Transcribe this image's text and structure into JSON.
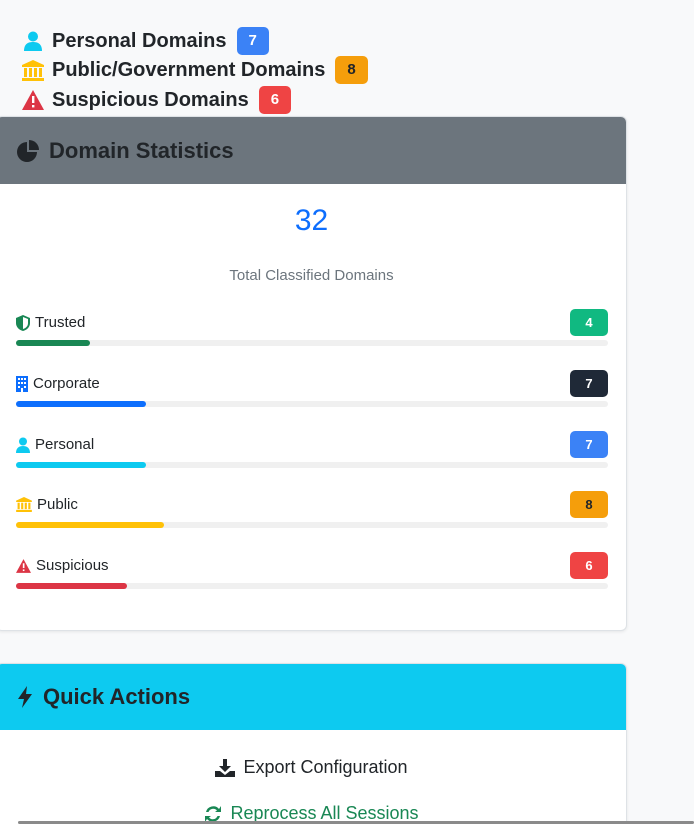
{
  "domain_headings": [
    {
      "label": "Personal Domains",
      "count": "7",
      "icon": "user-icon",
      "color": "#0dcaf0",
      "badge_bg": "#3b82f6",
      "badge_fg": "#ffffff"
    },
    {
      "label": "Public/Government Domains",
      "count": "8",
      "icon": "landmark-icon",
      "color": "#ffc107",
      "badge_bg": "#f59e0b",
      "badge_fg": "#212529"
    },
    {
      "label": "Suspicious Domains",
      "count": "6",
      "icon": "warning-icon",
      "color": "#dc3545",
      "badge_bg": "#ef4444",
      "badge_fg": "#ffffff"
    }
  ],
  "stats_card": {
    "title": "Domain Statistics",
    "header_bg": "#6c757d",
    "total": "32",
    "total_label": "Total Classified Domains",
    "rows": [
      {
        "label": "Trusted",
        "count": "4",
        "fraction": 0.125,
        "icon": "shield-icon",
        "icon_color": "#198754",
        "bar_color": "#198754",
        "badge_bg": "#10b981",
        "badge_fg": "#ffffff"
      },
      {
        "label": "Corporate",
        "count": "7",
        "fraction": 0.219,
        "icon": "building-icon",
        "icon_color": "#0d6efd",
        "bar_color": "#0d6efd",
        "badge_bg": "#1f2937",
        "badge_fg": "#ffffff"
      },
      {
        "label": "Personal",
        "count": "7",
        "fraction": 0.219,
        "icon": "user-icon",
        "icon_color": "#0dcaf0",
        "bar_color": "#0dcaf0",
        "badge_bg": "#3b82f6",
        "badge_fg": "#ffffff"
      },
      {
        "label": "Public",
        "count": "8",
        "fraction": 0.25,
        "icon": "landmark-icon",
        "icon_color": "#ffc107",
        "bar_color": "#ffc107",
        "badge_bg": "#f59e0b",
        "badge_fg": "#212529"
      },
      {
        "label": "Suspicious",
        "count": "6",
        "fraction": 0.188,
        "icon": "warning-icon",
        "icon_color": "#dc3545",
        "bar_color": "#dc3545",
        "badge_bg": "#ef4444",
        "badge_fg": "#ffffff"
      }
    ]
  },
  "actions_card": {
    "title": "Quick Actions",
    "header_bg": "#0dcaf0",
    "actions": [
      {
        "label": "Export Configuration",
        "icon": "download-icon",
        "color": "#212529"
      },
      {
        "label": "Reprocess All Sessions",
        "icon": "sync-icon",
        "color": "#198754"
      }
    ]
  }
}
